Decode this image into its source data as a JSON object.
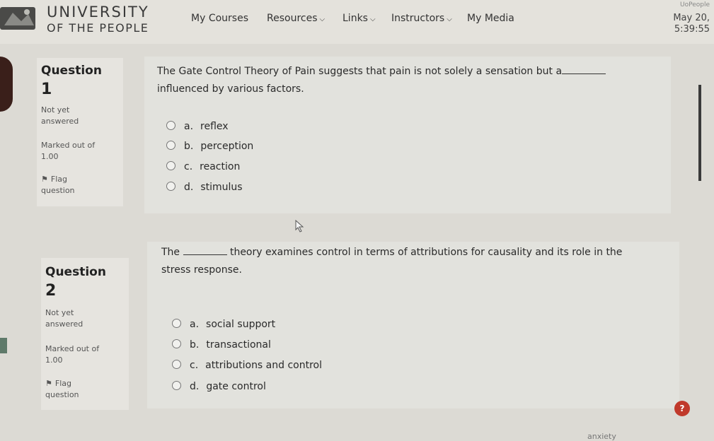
{
  "header": {
    "logo_line1": "UNIVERSITY",
    "logo_line2": "OF THE PEOPLE",
    "nav": [
      {
        "label": "My Courses",
        "dropdown": false
      },
      {
        "label": "Resources",
        "dropdown": true
      },
      {
        "label": "Links",
        "dropdown": true
      },
      {
        "label": "Instructors",
        "dropdown": true
      },
      {
        "label": "My Media",
        "dropdown": false
      }
    ],
    "right_top": "UoPeople",
    "date": "May 20,",
    "time": "5:39:55"
  },
  "questions": [
    {
      "label": "Question",
      "number": "1",
      "status_line1": "Not yet",
      "status_line2": "answered",
      "marked_line1": "Marked out of",
      "marked_value": "1.00",
      "flag_line1": "Flag",
      "flag_line2": "question",
      "text_line1": "The Gate Control Theory of Pain suggests that pain is not solely a sensation but a",
      "text_line2": "influenced by various factors.",
      "options": [
        {
          "letter": "a.",
          "text": "reflex"
        },
        {
          "letter": "b.",
          "text": "perception"
        },
        {
          "letter": "c.",
          "text": "reaction"
        },
        {
          "letter": "d.",
          "text": "stimulus"
        }
      ]
    },
    {
      "label": "Question",
      "number": "2",
      "status_line1": "Not yet",
      "status_line2": "answered",
      "marked_line1": "Marked out of",
      "marked_value": "1.00",
      "flag_line1": "Flag",
      "flag_line2": "question",
      "text_pre": "The",
      "text_post": "theory examines control in terms of attributions for causality and its role in the",
      "text_line2": "stress response.",
      "options": [
        {
          "letter": "a.",
          "text": "social support"
        },
        {
          "letter": "b.",
          "text": "transactional"
        },
        {
          "letter": "c.",
          "text": "attributions and control"
        },
        {
          "letter": "d.",
          "text": "gate control"
        }
      ]
    }
  ],
  "help_label": "?",
  "footer_text": "anxiety",
  "colors": {
    "help_button": "#c0392b",
    "background": "#dcdad4"
  }
}
